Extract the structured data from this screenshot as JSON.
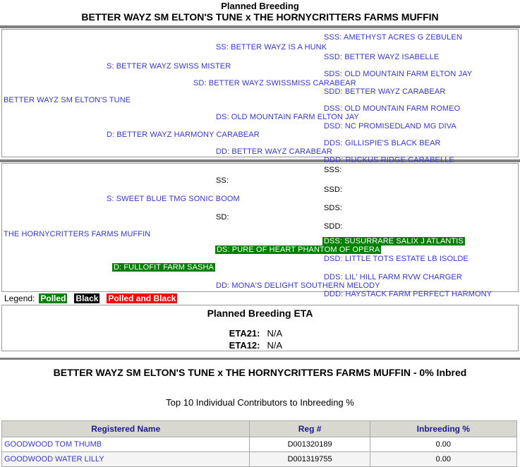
{
  "header": {
    "line1": "Planned Breeding",
    "line2": "BETTER WAYZ SM ELTON'S TUNE x THE HORNYCRITTERS FARMS MUFFIN"
  },
  "pedigree_sire": {
    "animal": "BETTER WAYZ SM ELTON'S TUNE",
    "s": "S: BETTER WAYZ SWISS MISTER",
    "ss": "SS: BETTER WAYZ IS A HUNK",
    "sss": "SSS: AMETHYST ACRES G ZEBULEN",
    "ssd": "SSD: BETTER WAYZ ISABELLE",
    "sd": "SD: BETTER WAYZ SWISSMISS CARABEAR",
    "sds": "SDS: OLD MOUNTAIN FARM ELTON JAY",
    "sdd": "SDD: BETTER WAYZ CARABEAR",
    "d": "D: BETTER WAYZ HARMONY CARABEAR",
    "ds": "DS: OLD MOUNTAIN FARM ELTON JAY",
    "dss": "DSS: OLD MOUNTAIN FARM ROMEO",
    "dsd": "DSD: NC PROMISEDLAND MG DIVA",
    "dd": "DD: BETTER WAYZ CARABEAR",
    "dds": "DDS: GILLISPIE'S BLACK BEAR",
    "ddd": "DDD: RUCKUS RIDGE CARABELLE"
  },
  "pedigree_dam": {
    "animal": "THE HORNYCRITTERS FARMS MUFFIN",
    "s": "S: SWEET BLUE TMG SONIC BOOM",
    "ss": "SS:",
    "sss": "SSS:",
    "ssd": "SSD:",
    "sd": "SD:",
    "sds": "SDS:",
    "sdd": "SDD:",
    "d": "D: FULLOFIT FARM SASHA",
    "ds": "DS: PURE OF HEART PHANTOM OF OPERA",
    "dss": "DSS: SUSURRARE SALIX J ATLANTIS",
    "dsd": "DSD: LITTLE TOTS ESTATE LB ISOLDE",
    "dd": "DD: MONA'S DELIGHT SOUTHERN MELODY",
    "dds": "DDS: LIL' HILL FARM RVW CHARGER",
    "ddd": "DDD: HAYSTACK FARM PERFECT HARMONY"
  },
  "legend": {
    "label": "Legend:",
    "polled": "Polled",
    "black": "Black",
    "polled_and_black": "Polled and Black",
    "color_polled": "#008000",
    "color_black": "#000000",
    "color_polled_and_black": "#ff0000"
  },
  "eta": {
    "title": "Planned Breeding ETA",
    "rows": [
      {
        "key": "ETA21:",
        "value": "N/A"
      },
      {
        "key": "ETA12:",
        "value": "N/A"
      }
    ]
  },
  "summary": {
    "title": "BETTER WAYZ SM ELTON'S TUNE x THE HORNYCRITTERS FARMS MUFFIN - 0% Inbred",
    "contributors_title": "Top 10 Individual Contributors to Inbreeding %"
  },
  "contributors_table": {
    "columns": [
      "Registered Name",
      "Reg #",
      "Inbreeding %"
    ],
    "rows": [
      {
        "name": "GOODWOOD TOM THUMB",
        "reg": "D001320189",
        "inbreeding": "0.00"
      },
      {
        "name": "GOODWOOD WATER LILLY",
        "reg": "D001319755",
        "inbreeding": "0.00"
      }
    ]
  }
}
